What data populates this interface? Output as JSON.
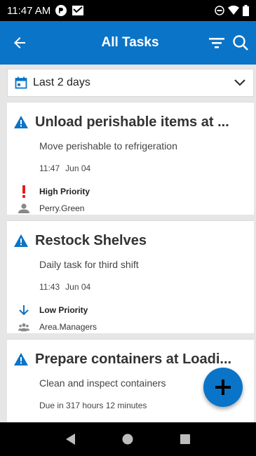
{
  "status_bar": {
    "time": "11:47 AM",
    "left_icons": [
      "sync-icon",
      "message-icon"
    ],
    "right_icons": [
      "do-not-disturb-icon",
      "wifi-icon",
      "battery-icon"
    ]
  },
  "app_bar": {
    "title": "All Tasks",
    "back_icon": "arrow-left-icon",
    "filter_icon": "filter-icon",
    "search_icon": "search-icon",
    "color": "#0a74c8"
  },
  "date_filter": {
    "label": "Last 2 days",
    "icon": "calendar-icon"
  },
  "tasks": [
    {
      "title": "Unload perishable items at ...",
      "description": "Move perishable to refrigeration",
      "time": "11:47",
      "date": "Jun 04",
      "priority": "High Priority",
      "assignee": "Perry.Green"
    },
    {
      "title": "Restock Shelves",
      "description": "Daily task for third shift",
      "time": "11:43",
      "date": "Jun 04",
      "priority": "Low Priority",
      "assignee": "Area.Managers"
    },
    {
      "title": "Prepare containers at Loadi...",
      "description": "Clean and inspect containers",
      "due": "Due in 317 hours 12 minutes"
    }
  ],
  "colors": {
    "accent": "#0a74c8",
    "high_priority": "#e02020",
    "low_priority": "#0a74c8"
  }
}
